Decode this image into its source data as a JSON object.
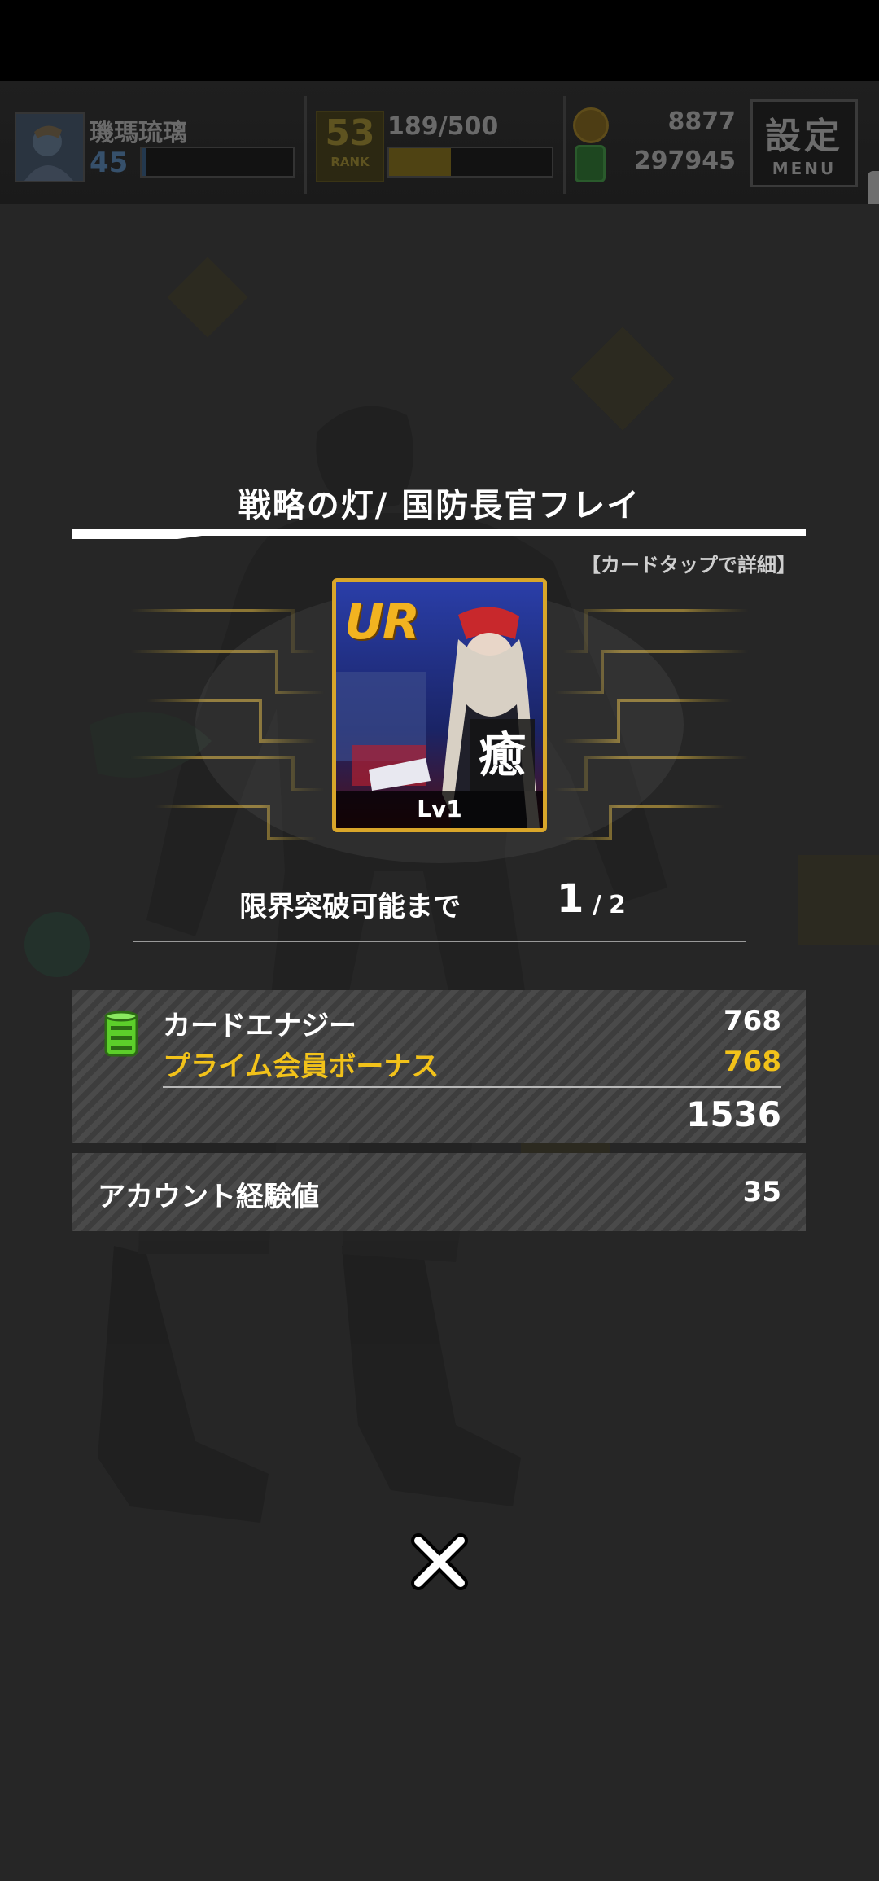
{
  "hud": {
    "player_name": "璣瑪琉璃",
    "player_level": "45",
    "level_progress": 0.03,
    "rank_number": "53",
    "rank_label": "RANK",
    "rank_exp": "189/500",
    "rank_progress": 0.378,
    "coins": "8877",
    "energy": "297945",
    "menu_kanji": "設定",
    "menu_label": "MENU"
  },
  "result": {
    "card_title": "戦略の灯/ 国防長官フレイ",
    "tap_hint": "【カードタップで詳細】",
    "card": {
      "rarity": "UR",
      "type_kanji": "癒",
      "level": "Lv1"
    },
    "limit_break": {
      "label": "限界突破可能まで",
      "current": "1",
      "slash": "/",
      "max": "2"
    },
    "rewards": {
      "card_energy_label": "カードエナジー",
      "card_energy_value": "768",
      "prime_bonus_label": "プライム会員ボーナス",
      "prime_bonus_value": "768",
      "total_value": "1536",
      "account_exp_label": "アカウント経験値",
      "account_exp_value": "35"
    }
  },
  "colors": {
    "gold_text": "#f2c21a",
    "card_frame": "#d9a62a",
    "energy_green": "#5ccf2a"
  },
  "icons": {
    "close": "close-x-icon",
    "energy": "energy-can-icon",
    "coin": "coin-icon"
  }
}
